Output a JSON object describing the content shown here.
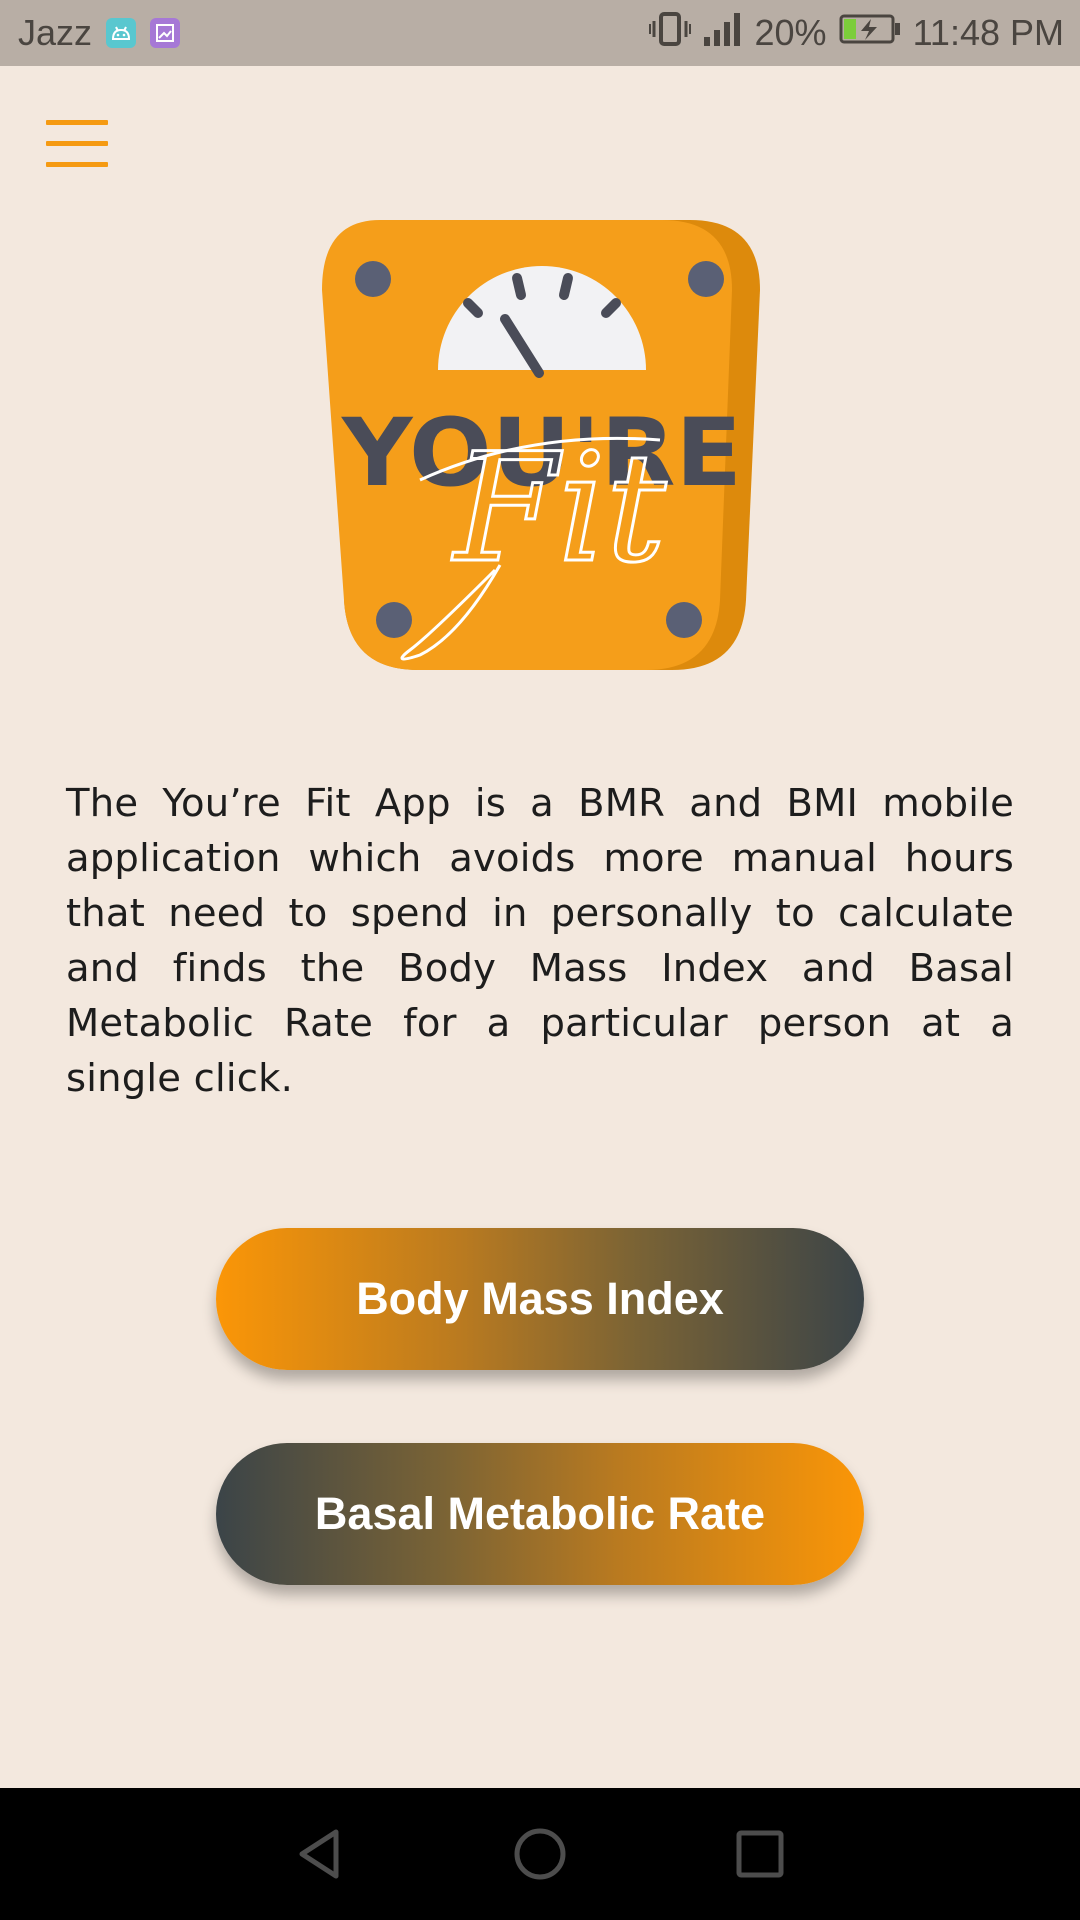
{
  "status_bar": {
    "carrier": "Jazz",
    "battery_percent": "20%",
    "time": "11:48 PM",
    "icons": [
      "android-icon",
      "gallery-icon",
      "vibrate-icon",
      "signal-icon",
      "battery-charging-icon"
    ]
  },
  "app_bar": {
    "menu_icon": "hamburger-menu-icon"
  },
  "logo": {
    "word_top": "YOU'RE",
    "word_script": "Fit",
    "colors": {
      "body": "#f59e1a",
      "body_shade": "#dd8a0c",
      "dial_face": "#f2f2f4",
      "dark": "#4a4c58",
      "bolt": "#5a6075"
    }
  },
  "description": "The You’re Fit App is a BMR and BMI mobile application which avoids more manual hours that need to spend in personally to calculate and finds the Body Mass Index and Basal Metabolic Rate for a particular person at a single click.",
  "buttons": {
    "bmi_label": "Body Mass Index",
    "bmr_label": "Basal Metabolic Rate"
  },
  "nav_bar": {
    "icons": [
      "back-icon",
      "home-icon",
      "recents-icon"
    ]
  },
  "colors": {
    "background": "#f3e8de",
    "accent_orange": "#fb9607",
    "accent_dark": "#3b4448",
    "status_bar": "#b8aea5"
  }
}
